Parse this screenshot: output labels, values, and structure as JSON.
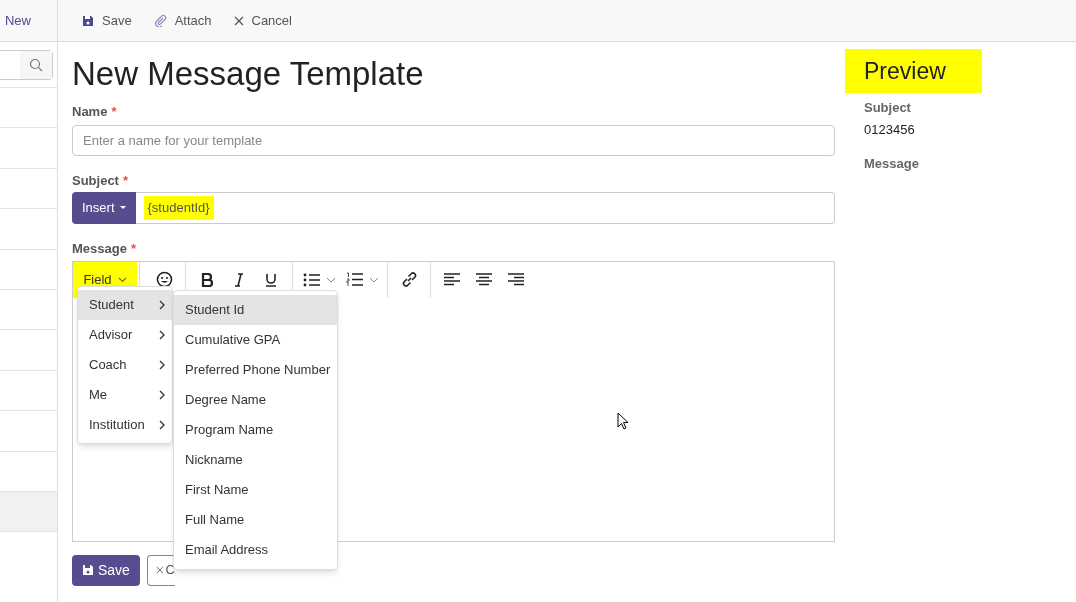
{
  "sidebar": {
    "new_label": "New"
  },
  "toolbar": [
    {
      "kind": "save",
      "label": "Save"
    },
    {
      "kind": "attach",
      "label": "Attach"
    },
    {
      "kind": "cancel",
      "label": "Cancel"
    }
  ],
  "title": "New Message Template",
  "name_field": {
    "label": "Name",
    "required_mark": "*",
    "placeholder": "Enter a name for your template"
  },
  "subject_field": {
    "label": "Subject",
    "required_mark": "*",
    "insert_button": "Insert",
    "value": "{studentId}",
    "highlighted": true
  },
  "message_field": {
    "label": "Message",
    "required_mark": "*"
  },
  "editor_toolbar": {
    "field_button": {
      "label": "Field",
      "highlighted": true,
      "expanded": true
    }
  },
  "field_menu": [
    {
      "label": "Student",
      "selected": true
    },
    {
      "label": "Advisor",
      "selected": false
    },
    {
      "label": "Coach",
      "selected": false
    },
    {
      "label": "Me",
      "selected": false
    },
    {
      "label": "Institution",
      "selected": false
    }
  ],
  "field_submenu": [
    {
      "label": "Student Id",
      "selected": true
    },
    {
      "label": "Cumulative GPA",
      "selected": false
    },
    {
      "label": "Preferred Phone Number",
      "selected": false
    },
    {
      "label": "Degree Name",
      "selected": false
    },
    {
      "label": "Program Name",
      "selected": false
    },
    {
      "label": "Nickname",
      "selected": false
    },
    {
      "label": "First Name",
      "selected": false
    },
    {
      "label": "Full Name",
      "selected": false
    },
    {
      "label": "Email Address",
      "selected": false
    }
  ],
  "footer_buttons": {
    "save": "Save",
    "cancel": "C"
  },
  "preview": {
    "title": "Preview",
    "highlighted": true,
    "subject_label": "Subject",
    "subject_value": "0123456",
    "message_label": "Message"
  }
}
